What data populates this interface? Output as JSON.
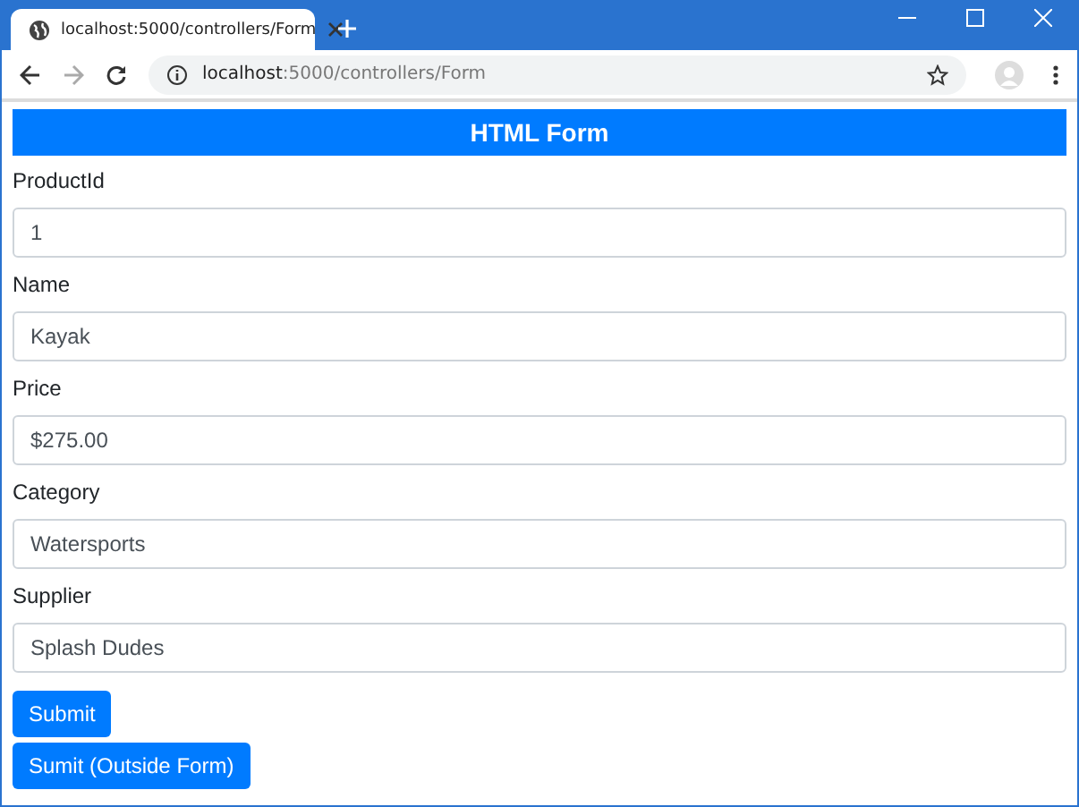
{
  "browser": {
    "tab_title": "localhost:5000/controllers/Form",
    "address": {
      "host": "localhost",
      "rest": ":5000/controllers/Form"
    }
  },
  "page": {
    "heading": "HTML Form",
    "fields": [
      {
        "label": "ProductId",
        "value": "1"
      },
      {
        "label": "Name",
        "value": "Kayak"
      },
      {
        "label": "Price",
        "value": "$275.00"
      },
      {
        "label": "Category",
        "value": "Watersports"
      },
      {
        "label": "Supplier",
        "value": "Splash Dudes"
      }
    ],
    "buttons": [
      "Submit",
      "Sumit (Outside Form)"
    ]
  }
}
